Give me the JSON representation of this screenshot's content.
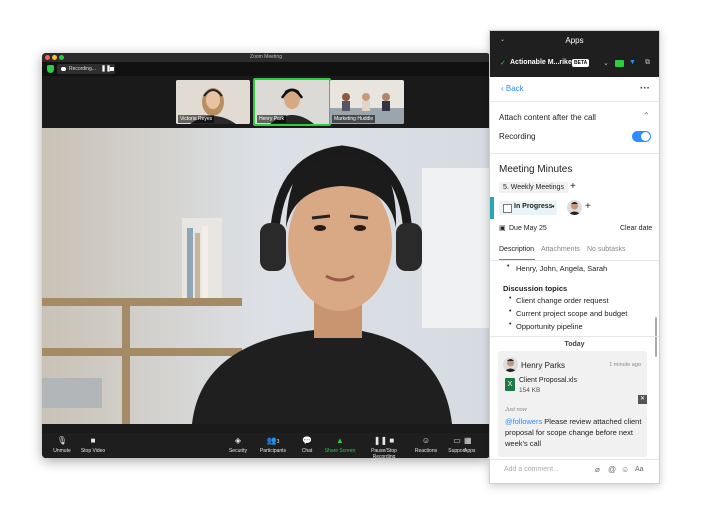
{
  "zoom": {
    "window_title": "Zoom Meeting",
    "recording_label": "Recording...",
    "participants": [
      {
        "name": "Victoria Reyes"
      },
      {
        "name": "Henry Park"
      },
      {
        "name": "Marketing Huddle"
      }
    ],
    "toolbar": {
      "unmute": "Unmute",
      "stop_video": "Stop Video",
      "security": "Security",
      "participants": "Participants",
      "participants_count": "3",
      "chat": "Chat",
      "share_screen": "Share Screen",
      "pause_stop_recording": "Pause/Stop Recording",
      "reactions": "Reactions",
      "support": "Support",
      "apps": "Apps"
    }
  },
  "panel": {
    "header_title": "Apps",
    "app_name": "Actionable M...rike",
    "beta": "BETA",
    "back": "Back",
    "attach_label": "Attach content after the call",
    "recording_label": "Recording",
    "recording_on": true,
    "task_title": "Meeting Minutes",
    "folder_chip": "5. Weekly Meetings",
    "status": "In Progress",
    "due": "Due May 25",
    "clear_date": "Clear date",
    "tabs": [
      "Description",
      "Attachments",
      "No subtasks"
    ],
    "attendees": "Henry, John, Angela, Sarah",
    "discussion_heading": "Discussion topics",
    "topics": [
      "Client change order request",
      "Current project scope and budget",
      "Opportunity pipeline"
    ],
    "today": "Today",
    "comment": {
      "author": "Henry Parks",
      "time": "1 minute ago",
      "file_name": "Client Proposal.xls",
      "file_size": "154 KB",
      "just_now": "Just now",
      "mention": "@followers",
      "text": " Please review attached client proposal for scope change before next week's call"
    },
    "input_placeholder": "Add a comment...",
    "format_label": "Aa"
  },
  "colors": {
    "accent": "#2d8cff",
    "status_bar": "#2aa5b2",
    "excel": "#1e7a45",
    "zoom_green": "#2ecc40"
  }
}
